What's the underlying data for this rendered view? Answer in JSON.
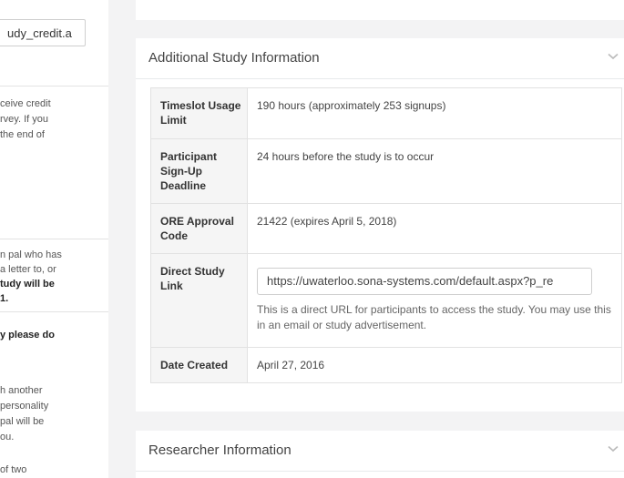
{
  "left": {
    "input_value": "udy_credit.a",
    "lines_a": [
      "ceive credit",
      "rvey. If you",
      "the end of"
    ],
    "lines_b": [
      "n pal who has",
      "a letter to, or"
    ],
    "lines_b_bold": [
      "tudy will be",
      "1."
    ],
    "line_c_bold": "y please do",
    "lines_d": [
      "h another",
      "personality",
      "pal will be",
      "ou."
    ],
    "line_e": "of two"
  },
  "additional": {
    "title": "Additional Study Information",
    "rows": {
      "usage_label": "Timeslot Usage Limit",
      "usage_value": "190 hours (approximately 253 signups)",
      "deadline_label": "Participant Sign-Up Deadline",
      "deadline_value": "24 hours before the study is to occur",
      "ore_label": "ORE Approval Code",
      "ore_value": "21422 (expires April 5, 2018)",
      "link_label": "Direct Study Link",
      "link_value": "https://uwaterloo.sona-systems.com/default.aspx?p_re",
      "link_help": "This is a direct URL for participants to access the study. You may use this in an email or study advertisement.",
      "created_label": "Date Created",
      "created_value": "April 27, 2016"
    }
  },
  "researcher": {
    "title": "Researcher Information"
  },
  "icons": {
    "collapse": "chevron-down-icon"
  }
}
